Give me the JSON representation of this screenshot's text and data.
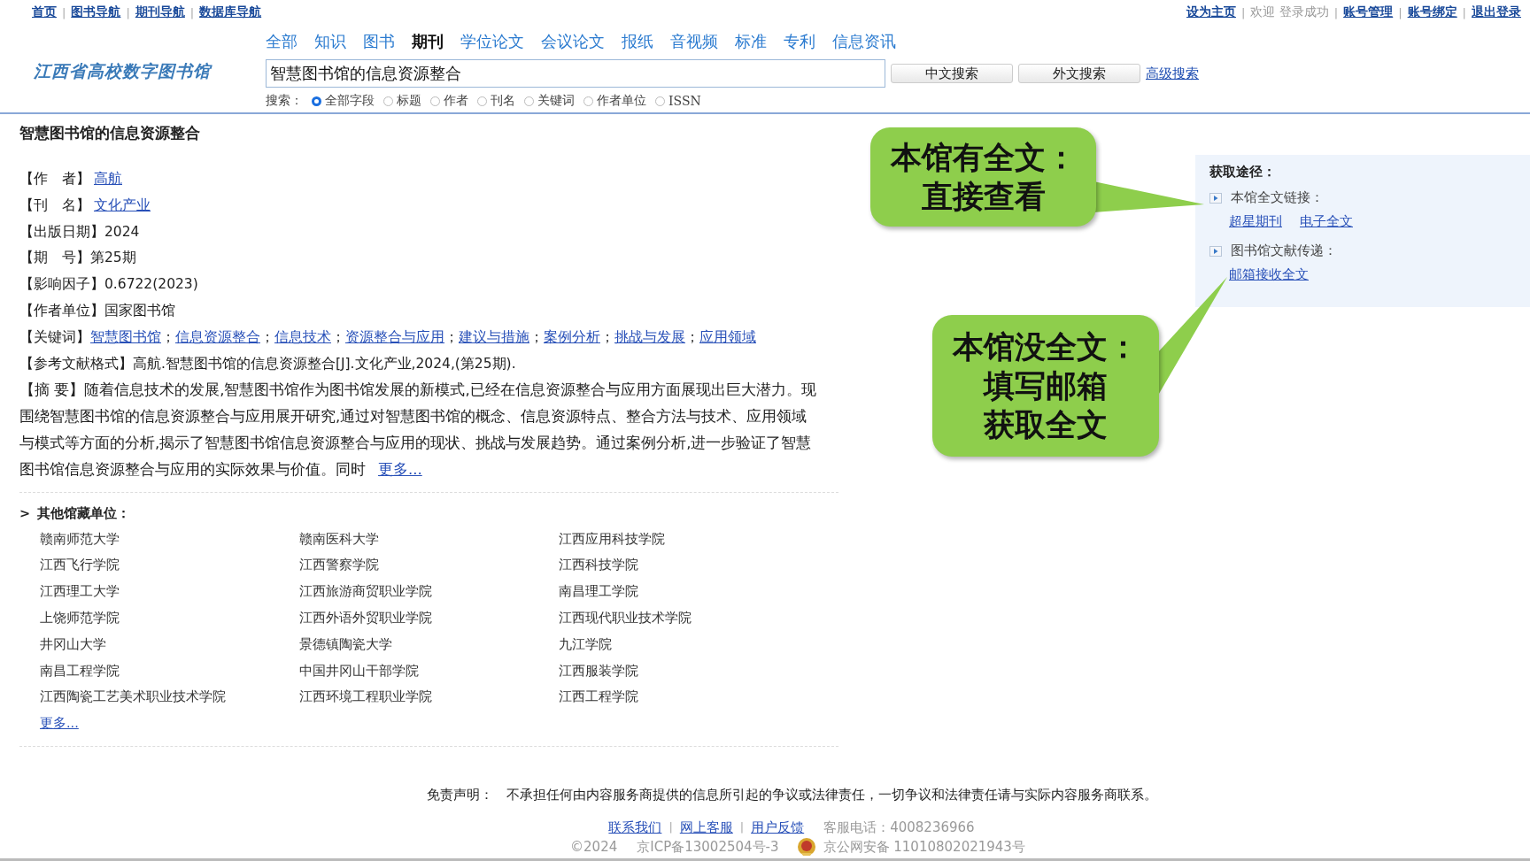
{
  "top_links": {
    "separator": "|",
    "left": [
      "首页",
      "图书导航",
      "期刊导航",
      "数据库导航"
    ],
    "right": [
      {
        "text": "设为主页",
        "kind": "link"
      },
      {
        "text": "欢迎 登录成功",
        "kind": "text"
      },
      {
        "text": "账号管理",
        "kind": "link"
      },
      {
        "text": "账号绑定",
        "kind": "link"
      },
      {
        "text": "退出登录",
        "kind": "link"
      }
    ]
  },
  "logo": "江西省高校数字图书馆",
  "channels": [
    {
      "label": "全部",
      "selected": false
    },
    {
      "label": "知识",
      "selected": false
    },
    {
      "label": "图书",
      "selected": false
    },
    {
      "label": "期刊",
      "selected": true
    },
    {
      "label": "学位论文",
      "selected": false
    },
    {
      "label": "会议论文",
      "selected": false
    },
    {
      "label": "报纸",
      "selected": false
    },
    {
      "label": "音视频",
      "selected": false
    },
    {
      "label": "标准",
      "selected": false
    },
    {
      "label": "专利",
      "selected": false
    },
    {
      "label": "信息资讯",
      "selected": false
    }
  ],
  "search": {
    "value": "智慧图书馆的信息资源整合",
    "buttons": [
      "中文搜索",
      "外文搜索"
    ],
    "advanced": "高级搜索",
    "scope_label": "搜索：",
    "scopes": [
      {
        "label": "全部字段",
        "selected": true
      },
      {
        "label": "标题",
        "selected": false
      },
      {
        "label": "作者",
        "selected": false
      },
      {
        "label": "刊名",
        "selected": false
      },
      {
        "label": "关键词",
        "selected": false
      },
      {
        "label": "作者单位",
        "selected": false
      },
      {
        "label": "ISSN",
        "selected": false
      }
    ]
  },
  "article": {
    "title": "智慧图书馆的信息资源整合",
    "fields": [
      {
        "label": "【作　者】",
        "value": "高航",
        "kind": "link"
      },
      {
        "label": "【刊　名】",
        "value": "文化产业",
        "kind": "link"
      },
      {
        "label": "【出版日期】",
        "value": "2024",
        "kind": "text"
      },
      {
        "label": "【期　号】",
        "value": "第25期",
        "kind": "text"
      },
      {
        "label": "【影响因子】",
        "value": "0.6722(2023)",
        "kind": "text"
      },
      {
        "label": "【作者单位】",
        "value": "国家图书馆",
        "kind": "text"
      }
    ],
    "keywords_label": "【关键词】",
    "keyword_separator": "；",
    "keywords": [
      "智慧图书馆",
      "信息资源整合",
      "信息技术",
      "资源整合与应用",
      "建议与措施",
      "案例分析",
      "挑战与发展",
      "应用领域"
    ],
    "citation_label": "【参考文献格式】",
    "citation": "高航.智慧图书馆的信息资源整合[J].文化产业,2024,(第25期).",
    "abstract_label": "【摘 要】",
    "abstract": "随着信息技术的发展,智慧图书馆作为图书馆发展的新模式,已经在信息资源整合与应用方面展现出巨大潜力。现围绕智慧图书馆的信息资源整合与应用展开研究,通过对智慧图书馆的概念、信息资源特点、整合方法与技术、应用领域与模式等方面的分析,揭示了智慧图书馆信息资源整合与应用的现状、挑战与发展趋势。通过案例分析,进一步验证了智慧图书馆信息资源整合与应用的实际效果与价值。同时",
    "abstract_more": "更多..."
  },
  "holdings": {
    "marker": ">",
    "title": "其他馆藏单位：",
    "items": [
      "赣南师范大学",
      "赣南医科大学",
      "江西应用科技学院",
      "江西飞行学院",
      "江西警察学院",
      "江西科技学院",
      "江西理工大学",
      "江西旅游商贸职业学院",
      "南昌理工学院",
      "上饶师范学院",
      "江西外语外贸职业学院",
      "江西现代职业技术学院",
      "井冈山大学",
      "景德镇陶瓷大学",
      "九江学院",
      "南昌工程学院",
      "中国井冈山干部学院",
      "江西服装学院",
      "江西陶瓷工艺美术职业技术学院",
      "江西环境工程职业学院",
      "江西工程学院"
    ],
    "more": "更多..."
  },
  "access": {
    "title": "获取途径：",
    "groups": [
      {
        "label": "本馆全文链接：",
        "links": [
          "超星期刊",
          "电子全文"
        ]
      },
      {
        "label": "图书馆文献传递：",
        "links": [
          "邮箱接收全文"
        ]
      }
    ]
  },
  "callouts": [
    {
      "lines": [
        "本馆有全文：",
        "直接查看"
      ]
    },
    {
      "lines": [
        "本馆没全文：",
        "填写邮箱",
        "获取全文"
      ]
    }
  ],
  "footer": {
    "disclaimer": "免责声明：　不承担任何由内容服务商提供的信息所引起的争议或法律责任，一切争议和法律责任请与实际内容服务商联系。",
    "separator": "|",
    "links": [
      "联系我们",
      "网上客服",
      "用户反馈"
    ],
    "phone": "客服电话：4008236966",
    "copyright": "©2024",
    "icp": "京ICP备13002504号-3",
    "police": "京公网安备 11010802021943号"
  }
}
